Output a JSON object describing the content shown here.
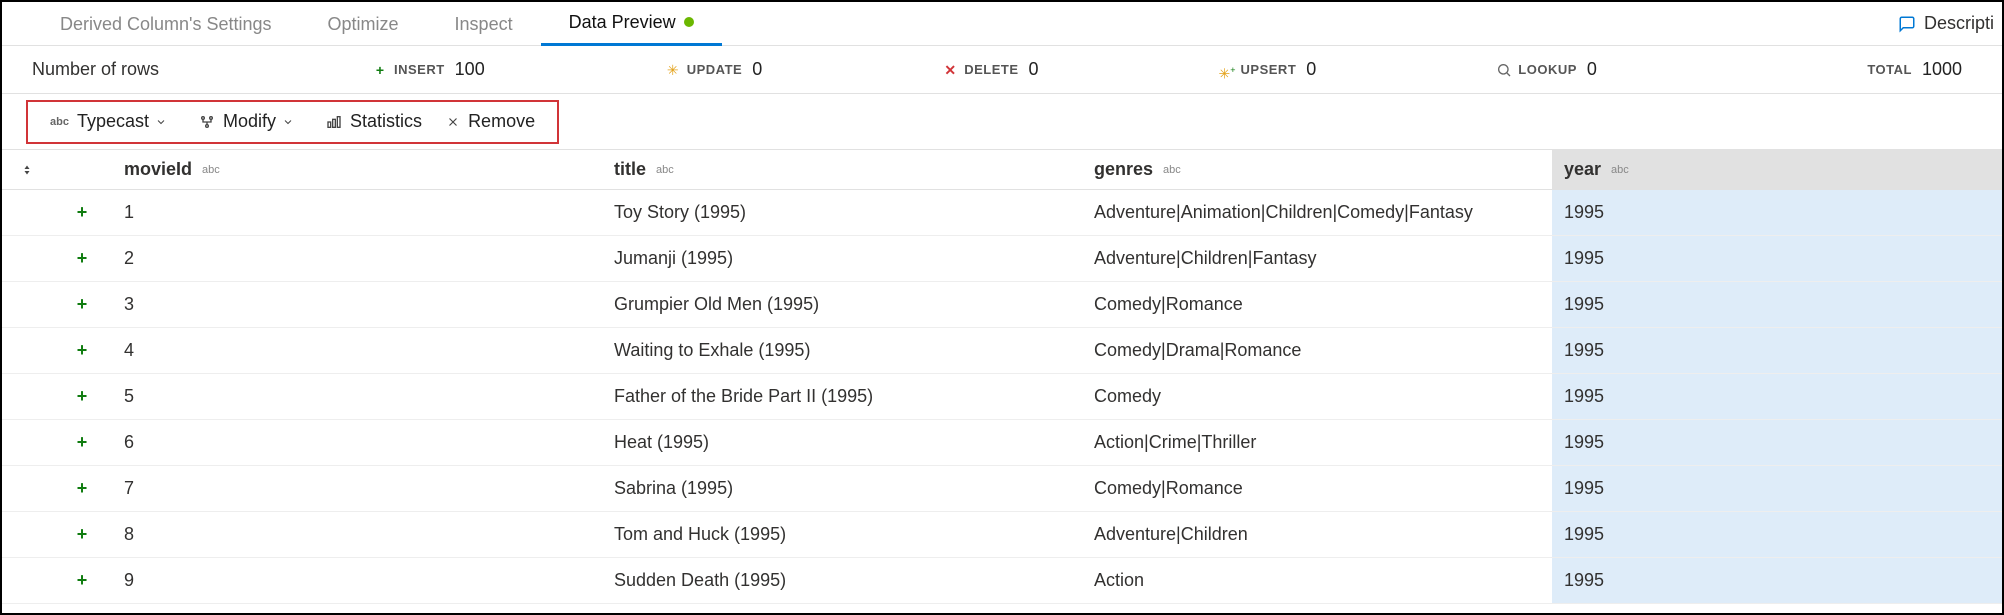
{
  "tabs": [
    {
      "label": "Derived Column's Settings",
      "active": false
    },
    {
      "label": "Optimize",
      "active": false
    },
    {
      "label": "Inspect",
      "active": false
    },
    {
      "label": "Data Preview",
      "active": true
    }
  ],
  "description_link": "Descripti",
  "stats": {
    "label": "Number of rows",
    "insert": {
      "label": "INSERT",
      "value": "100"
    },
    "update": {
      "label": "UPDATE",
      "value": "0"
    },
    "delete": {
      "label": "DELETE",
      "value": "0"
    },
    "upsert": {
      "label": "UPSERT",
      "value": "0"
    },
    "lookup": {
      "label": "LOOKUP",
      "value": "0"
    },
    "total": {
      "label": "TOTAL",
      "value": "1000"
    }
  },
  "toolbar": {
    "typecast": "Typecast",
    "modify": "Modify",
    "statistics": "Statistics",
    "remove": "Remove"
  },
  "columns": {
    "movieId": "movieId",
    "title": "title",
    "genres": "genres",
    "year": "year",
    "type_abc": "abc"
  },
  "rows": [
    {
      "movieId": "1",
      "title": "Toy Story (1995)",
      "genres": "Adventure|Animation|Children|Comedy|Fantasy",
      "year": "1995"
    },
    {
      "movieId": "2",
      "title": "Jumanji (1995)",
      "genres": "Adventure|Children|Fantasy",
      "year": "1995"
    },
    {
      "movieId": "3",
      "title": "Grumpier Old Men (1995)",
      "genres": "Comedy|Romance",
      "year": "1995"
    },
    {
      "movieId": "4",
      "title": "Waiting to Exhale (1995)",
      "genres": "Comedy|Drama|Romance",
      "year": "1995"
    },
    {
      "movieId": "5",
      "title": "Father of the Bride Part II (1995)",
      "genres": "Comedy",
      "year": "1995"
    },
    {
      "movieId": "6",
      "title": "Heat (1995)",
      "genres": "Action|Crime|Thriller",
      "year": "1995"
    },
    {
      "movieId": "7",
      "title": "Sabrina (1995)",
      "genres": "Comedy|Romance",
      "year": "1995"
    },
    {
      "movieId": "8",
      "title": "Tom and Huck (1995)",
      "genres": "Adventure|Children",
      "year": "1995"
    },
    {
      "movieId": "9",
      "title": "Sudden Death (1995)",
      "genres": "Action",
      "year": "1995"
    }
  ]
}
